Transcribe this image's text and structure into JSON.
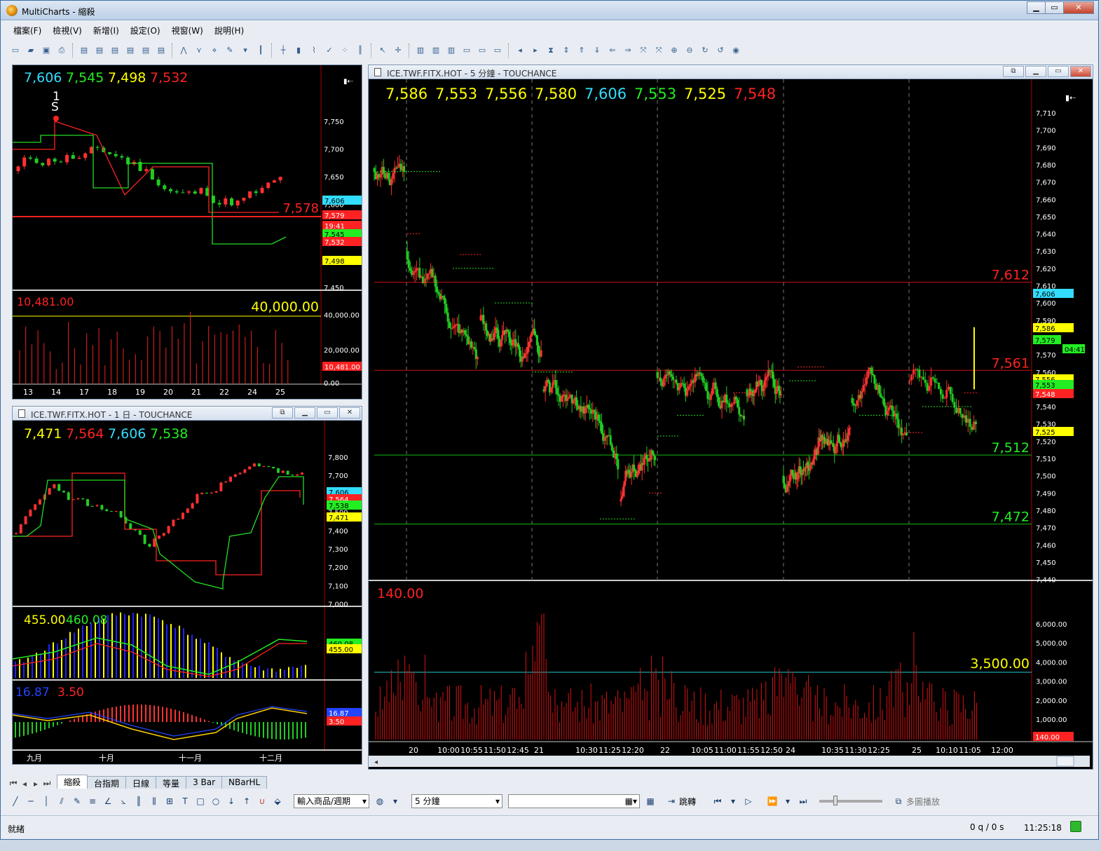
{
  "window": {
    "title": "MultiCharts - 縮殺",
    "min": "▁",
    "max": "▭",
    "close": "✕"
  },
  "menu": [
    "檔案(F)",
    "檢視(V)",
    "新增(I)",
    "設定(O)",
    "視窗(W)",
    "說明(H)"
  ],
  "toolbar_icons": [
    "new-icon",
    "open-icon",
    "save-icon",
    "print-icon",
    "chart-icon",
    "chart-icon",
    "chart-icon",
    "chart-icon",
    "chart-icon",
    "chart-icon",
    "cursor-icon",
    "crosshair-icon",
    "zoom-in-icon",
    "zoom-out-icon",
    "replay-icon"
  ],
  "chart_tl": {
    "header_values": [
      {
        "v": "7,606",
        "c": "#33ddff"
      },
      {
        "v": "7,545",
        "c": "#22ee22"
      },
      {
        "v": "7,498",
        "c": "#ffff00"
      },
      {
        "v": "7,532",
        "c": "#ff2222"
      }
    ],
    "signal_labels": [
      "1",
      "S"
    ],
    "price_line_label": "7,578",
    "axis_ticks": [
      "7,750",
      "7,700",
      "7,650",
      "7,600",
      "7,550",
      "7,500",
      "7,450"
    ],
    "price_tags": [
      {
        "v": "7,606",
        "c": "#33ddff"
      },
      {
        "v": "7,579",
        "c": "#ff2222"
      },
      {
        "v": "19:41",
        "c": "#ff2222"
      },
      {
        "v": "7,545",
        "c": "#22ee22"
      },
      {
        "v": "7,532",
        "c": "#ff2222"
      },
      {
        "v": "7,498",
        "c": "#ffff00"
      }
    ],
    "vol_left": "10,481.00",
    "vol_right": "40,000.00",
    "vol_ticks": [
      "40,000.00",
      "20,000.00",
      "0.00"
    ],
    "vol_tag": "10,481.00",
    "x_labels": [
      "13",
      "14",
      "17",
      "18",
      "19",
      "20",
      "21",
      "22",
      "24",
      "25"
    ]
  },
  "chart_bl": {
    "title": "ICE.TWF.FITX.HOT - 1 日 - TOUCHANCE",
    "header_values": [
      {
        "v": "7,471",
        "c": "#ffff00"
      },
      {
        "v": "7,564",
        "c": "#ff2222"
      },
      {
        "v": "7,606",
        "c": "#33ddff"
      },
      {
        "v": "7,538",
        "c": "#22ee22"
      }
    ],
    "axis_ticks": [
      "7,800",
      "7,700",
      "7,600",
      "7,500",
      "7,400",
      "7,300",
      "7,200",
      "7,100",
      "7,000"
    ],
    "price_tags": [
      {
        "v": "7,606",
        "c": "#33ddff"
      },
      {
        "v": "7,564",
        "c": "#ff2222"
      },
      {
        "v": "7,538",
        "c": "#22ee22"
      },
      {
        "v": "7,471",
        "c": "#ffff00"
      }
    ],
    "ind1_values": [
      {
        "v": "455.00",
        "c": "#ffff00"
      },
      {
        "v": "460.08",
        "c": "#22ee22"
      }
    ],
    "ind1_tags": [
      {
        "v": "460.08",
        "c": "#22ee22"
      },
      {
        "v": "455.00",
        "c": "#ffff00"
      }
    ],
    "ind2_values": [
      {
        "v": "16.87",
        "c": "#2244ff"
      },
      {
        "v": "3.50",
        "c": "#ff2222"
      }
    ],
    "ind2_tags": [
      {
        "v": "16.87",
        "c": "#2244ff"
      },
      {
        "v": "3.50",
        "c": "#ff2222"
      }
    ],
    "x_labels": [
      "九月",
      "十月",
      "十一月",
      "十二月"
    ]
  },
  "chart_main": {
    "title": "ICE.TWF.FITX.HOT - 5 分鐘 - TOUCHANCE",
    "header_values": [
      {
        "v": "7,586",
        "c": "#ffff00"
      },
      {
        "v": "7,553",
        "c": "#ffff00"
      },
      {
        "v": "7,556",
        "c": "#ffff00"
      },
      {
        "v": "7,580",
        "c": "#ffff00"
      },
      {
        "v": "7,606",
        "c": "#33ddff"
      },
      {
        "v": "7,553",
        "c": "#22ee22"
      },
      {
        "v": "7,525",
        "c": "#ffff00"
      },
      {
        "v": "7,548",
        "c": "#ff2222"
      }
    ],
    "axis_ticks": [
      "7,710",
      "7,700",
      "7,690",
      "7,680",
      "7,670",
      "7,660",
      "7,650",
      "7,640",
      "7,630",
      "7,620",
      "7,610",
      "7,600",
      "7,590",
      "7,580",
      "7,570",
      "7,560",
      "7,550",
      "7,540",
      "7,530",
      "7,520",
      "7,510",
      "7,500",
      "7,490",
      "7,480",
      "7,470",
      "7,460",
      "7,450",
      "7,440"
    ],
    "level_lines": [
      {
        "label": "7,612",
        "c": "#ff2222"
      },
      {
        "label": "7,561",
        "c": "#ff2222"
      },
      {
        "label": "7,512",
        "c": "#22ee22"
      },
      {
        "label": "7,472",
        "c": "#22ee22"
      }
    ],
    "price_tags": [
      {
        "v": "7,606",
        "c": "#33ddff"
      },
      {
        "v": "7,586",
        "c": "#ffff00"
      },
      {
        "v": "7,579",
        "c": "#22ee22"
      },
      {
        "v": "04:41",
        "c": "#22ee22"
      },
      {
        "v": "7,556",
        "c": "#ffff00"
      },
      {
        "v": "7,553",
        "c": "#22ee22"
      },
      {
        "v": "7,548",
        "c": "#ff2222"
      },
      {
        "v": "7,525",
        "c": "#ffff00"
      }
    ],
    "vol_left": "140.00",
    "vol_right": "3,500.00",
    "vol_ticks": [
      "6,000.00",
      "5,000.00",
      "4,000.00",
      "3,000.00",
      "2,000.00",
      "1,000.00"
    ],
    "vol_tag": "140.00",
    "x_labels": [
      "20",
      "10:00",
      "10:55",
      "11:50",
      "12:45",
      "21",
      "10:30",
      "11:25",
      "12:20",
      "22",
      "10:05",
      "11:00",
      "11:55",
      "12:50",
      "24",
      "10:35",
      "11:30",
      "12:25",
      "25",
      "10:10",
      "11:05",
      "12:00"
    ]
  },
  "tabs": [
    "縮殺",
    "台指期",
    "日線",
    "等量",
    "3 Bar",
    "NBarHL"
  ],
  "active_tab": 0,
  "draw_icons": [
    "line-icon",
    "hline-icon",
    "vline-icon",
    "channel-icon",
    "pencil-icon",
    "fib-icon",
    "gann-icon",
    "text-icon",
    "rect-icon",
    "ellipse-icon",
    "arrow-down-icon",
    "arrow-up-icon",
    "magnet-icon",
    "paint-icon"
  ],
  "symbol_select": "輸入商品/週期",
  "interval_select": "5 分鐘",
  "jump_label": "跳轉",
  "multi_play": "多圖播放",
  "status": {
    "left": "就緒",
    "queue": "0 q / 0 s",
    "time": "11:25:18"
  }
}
